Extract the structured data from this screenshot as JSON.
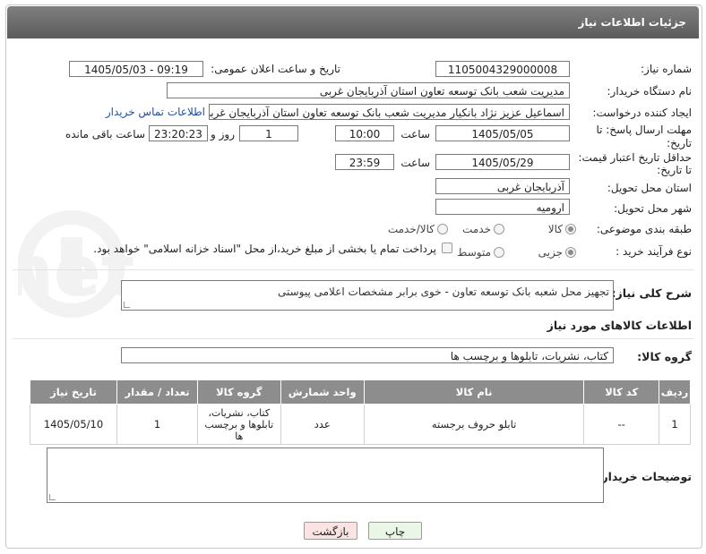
{
  "header": {
    "title": "جزئیات اطلاعات نیاز"
  },
  "fields": {
    "need_number_label": "شماره نیاز:",
    "need_number": "1105004329000008",
    "announce_label": "تاریخ و ساعت اعلان عمومی:",
    "announce_value": "1405/05/03 - 09:19",
    "buyer_org_label": "نام دستگاه خریدار:",
    "buyer_org": "مدیریت شعب بانک توسعه تعاون استان آذربایجان غربی",
    "creator_label": "ایجاد کننده درخواست:",
    "creator": "اسماعیل عزیز نژاد بانکیار مدیریت شعب بانک توسعه تعاون استان آذربایجان غربی",
    "contact_link": "اطلاعات تماس خریدار",
    "reply_deadline_label_1": "مهلت ارسال پاسخ: تا",
    "reply_deadline_label_2": "تاریخ:",
    "reply_date": "1405/05/05",
    "time_label": "ساعت",
    "reply_time": "10:00",
    "days_value": "1",
    "days_label": "روز و",
    "remaining_value": "23:20:23",
    "remaining_label": "ساعت باقی مانده",
    "price_deadline_label_1": "حداقل تاریخ اعتبار قیمت:",
    "price_deadline_label_2": "تا تاریخ:",
    "price_date": "1405/05/29",
    "price_time_label": "ساعت",
    "price_time": "23:59",
    "province_label": "استان محل تحویل:",
    "province": "آذربایجان غربی",
    "city_label": "شهر محل تحویل:",
    "city": "ارومیه",
    "category_label": "طبقه بندی موضوعی:",
    "category_options": [
      "کالا",
      "خدمت",
      "کالا/خدمت"
    ],
    "process_label": "نوع فرآیند خرید :",
    "process_options": [
      "جزیی",
      "متوسط"
    ],
    "payment_note": "پرداخت تمام یا بخشی از مبلغ خرید،از محل \"اسناد خزانه اسلامی\" خواهد بود."
  },
  "description": {
    "label": "شرح کلی نیاز:",
    "text": "تجهیز محل شعبه بانک توسعه تعاون - خوی   برابر مشخصات اعلامی پیوستی"
  },
  "goods": {
    "section_title": "اطلاعات کالاهای مورد نیاز",
    "group_label": "گروه کالا:",
    "group_value": "کتاب، نشریات، تابلوها و برچسب ها",
    "columns": [
      "ردیف",
      "کد کالا",
      "نام کالا",
      "واحد شمارش",
      "گروه کالا",
      "تعداد / مقدار",
      "تاریخ نیاز"
    ],
    "rows": [
      {
        "row": "1",
        "code": "--",
        "name": "تابلو حروف برجسته",
        "unit": "عدد",
        "group": "کتاب، نشریات، تابلوها و برچسب ها",
        "qty": "1",
        "date": "1405/05/10"
      }
    ]
  },
  "buyer_notes": {
    "label": "توضیحات خریدار:"
  },
  "buttons": {
    "print": "چاپ",
    "back": "بازگشت"
  },
  "watermark": {
    "text": "AriaTender.net"
  },
  "colors": {
    "header": "#6e6e6e",
    "table_header": "#8d8d8d",
    "back_button": "#fbe3e3",
    "print_button": "#eaf6e6",
    "link": "#1f4fa8"
  }
}
